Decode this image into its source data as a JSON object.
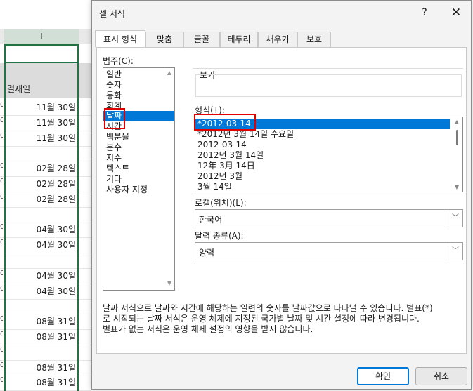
{
  "sheet": {
    "column_letter": "I",
    "header": "결재일",
    "rows": [
      {
        "edge": "0",
        "value": "11월 30일"
      },
      {
        "edge": "0",
        "value": "11월 30일"
      },
      {
        "edge": "0",
        "value": "11월 30일"
      },
      {
        "edge": "",
        "value": ""
      },
      {
        "edge": "0",
        "value": "02월 28일"
      },
      {
        "edge": "0",
        "value": "02월 28일"
      },
      {
        "edge": "0",
        "value": "02월 28일"
      },
      {
        "edge": "",
        "value": ""
      },
      {
        "edge": "0",
        "value": "04월 30일"
      },
      {
        "edge": "0",
        "value": "04월 30일"
      },
      {
        "edge": "",
        "value": ""
      },
      {
        "edge": "0",
        "value": "04월 30일"
      },
      {
        "edge": "0",
        "value": "04월 30일"
      },
      {
        "edge": "",
        "value": ""
      },
      {
        "edge": "0",
        "value": "08월 31일"
      },
      {
        "edge": "0",
        "value": "08월 31일"
      },
      {
        "edge": "0",
        "value": ""
      },
      {
        "edge": "0",
        "value": "08월 31일"
      },
      {
        "edge": "0",
        "value": "08월 31일"
      }
    ]
  },
  "dialog": {
    "title": "셀 서식",
    "help": "?",
    "close": "✕",
    "tabs": [
      "표시 형식",
      "맞춤",
      "글꼴",
      "테두리",
      "채우기",
      "보호"
    ],
    "category_label": "범주(C):",
    "categories": [
      "일반",
      "숫자",
      "통화",
      "회계",
      "날짜",
      "시간",
      "백분율",
      "분수",
      "지수",
      "텍스트",
      "기타",
      "사용자 지정"
    ],
    "selected_category": "날짜",
    "sample_label": "보기",
    "format_label": "형식(T):",
    "formats": [
      "*2012-03-14",
      "*2012년 3월 14일 수요일",
      "2012-03-14",
      "2012년 3월 14일",
      "12年 3月 14日",
      "2012년 3월",
      "3월 14일"
    ],
    "selected_format": "*2012-03-14",
    "locale_label": "로캘(위치)(L):",
    "locale_value": "한국어",
    "calendar_label": "달력 종류(A):",
    "calendar_value": "양력",
    "description": [
      "날짜 서식으로 날짜와 시간에 해당하는 일련의 숫자를 날짜값으로 나타낼 수 있습니다. 별표(*)",
      "로 시작되는 날짜 서식은 운영 체제에 지정된 국가별 날짜 및 시간 설정에 따라 변경됩니다.",
      "별표가 없는 서식은 운영 체제 설정의 영향을 받지 않습니다."
    ],
    "ok": "확인",
    "cancel": "취소"
  },
  "colors": {
    "selection": "#0078d7",
    "annotation_red": "#e00000",
    "excel_green": "#217346"
  }
}
